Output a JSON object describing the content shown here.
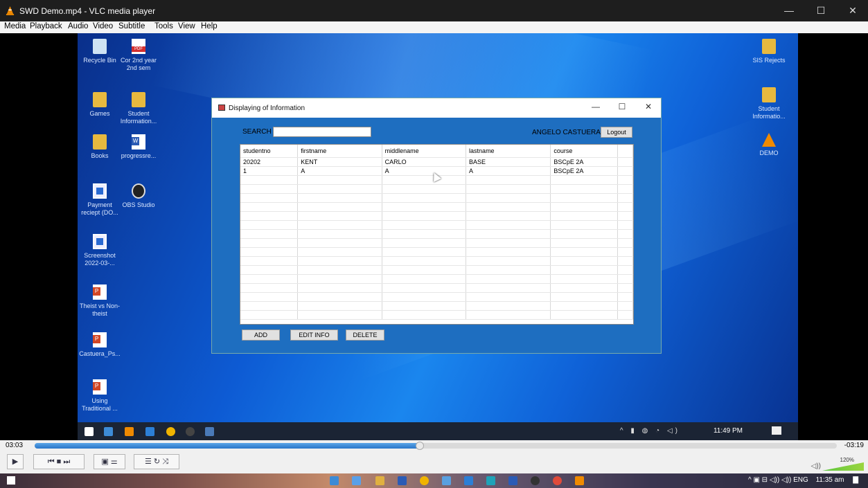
{
  "window": {
    "title": "SWD Demo.mp4 - VLC media player",
    "minimize_label": "—",
    "maximize_label": "☐",
    "close_label": "✕"
  },
  "menu": [
    "Media",
    "Playback",
    "Audio",
    "Video",
    "Subtitle",
    "Tools",
    "View",
    "Help"
  ],
  "desktop": {
    "icons": [
      {
        "label": "Recycle Bin",
        "icon": "recycle-bin-icon"
      },
      {
        "label": "Cor 2nd year 2nd sem",
        "icon": "pdf-icon"
      },
      {
        "label": "Games",
        "icon": "folder-icon"
      },
      {
        "label": "Student Information...",
        "icon": "zip-folder-icon"
      },
      {
        "label": "Books",
        "icon": "folder-icon"
      },
      {
        "label": "progressre...",
        "icon": "word-doc-icon"
      },
      {
        "label": "Payment reciept (DO...",
        "icon": "image-file-icon"
      },
      {
        "label": "OBS Studio",
        "icon": "obs-icon"
      },
      {
        "label": "Screenshot 2022-03-...",
        "icon": "image-file-icon"
      },
      {
        "label": "Theist vs Non-theist",
        "icon": "powerpoint-icon"
      },
      {
        "label": "Castuera_Ps...",
        "icon": "powerpoint-icon"
      },
      {
        "label": "Using Traditional ...",
        "icon": "powerpoint-icon"
      },
      {
        "label": "SIS Rejects",
        "icon": "folder-icon"
      },
      {
        "label": "Student Informatio...",
        "icon": "folder-icon"
      },
      {
        "label": "DEMO",
        "icon": "vlc-icon"
      }
    ]
  },
  "app": {
    "title": "Displaying of Information",
    "search_label": "SEARCH",
    "search_value": "",
    "user_name": "ANGELO CASTUERA",
    "logout_label": "Logout",
    "columns": [
      "studentno",
      "firstname",
      "middlename",
      "lastname",
      "course"
    ],
    "rows": [
      [
        "20202",
        "KENT",
        "CARLO",
        "BASE",
        "BSCpE 2A"
      ],
      [
        "1",
        "A",
        "A",
        "A",
        "BSCpE 2A"
      ]
    ],
    "add_label": "ADD",
    "edit_label": "EDIT INFO",
    "delete_label": "DELETE"
  },
  "inner_taskbar": {
    "clock": "11:49 PM"
  },
  "player": {
    "elapsed": "03:03",
    "remaining": "-03:19",
    "progress_fraction": 0.48,
    "volume": "120%",
    "volume_fraction": 1.0
  },
  "host_taskbar": {
    "language": "ENG",
    "clock": "11:35 am"
  }
}
